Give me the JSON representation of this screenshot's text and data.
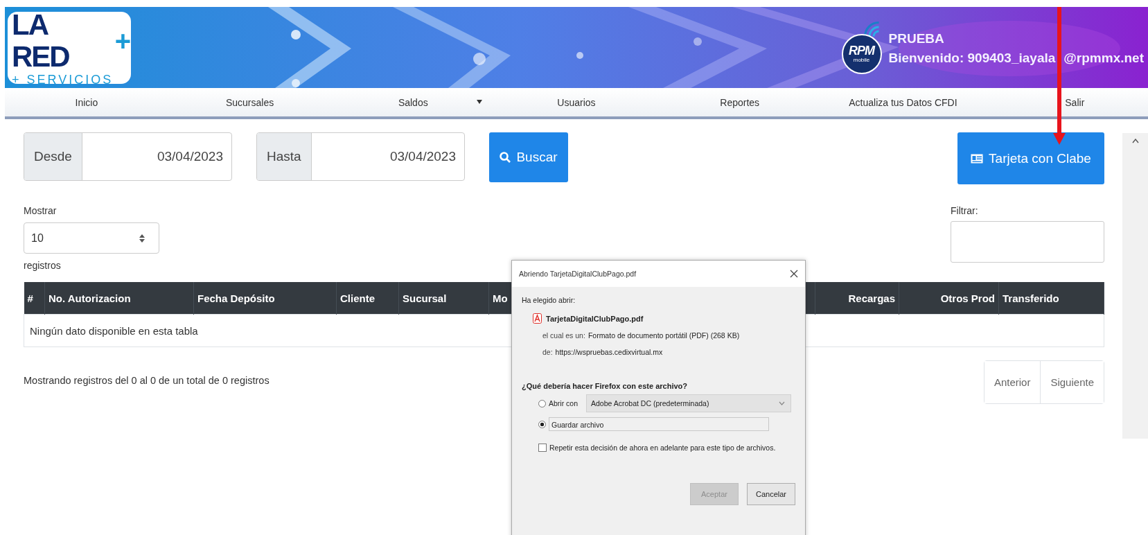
{
  "header": {
    "logo": {
      "main": "LA RED",
      "plus": "+",
      "sub": "+ SERVICIOS"
    },
    "brand": {
      "name": "RPM",
      "sub": "mobile"
    },
    "company": "PRUEBA",
    "welcome": "Bienvenido: 909403_iayala",
    "welcome_rest": "@rpmmx.net"
  },
  "nav": [
    {
      "label": "Inicio",
      "dropdown": false
    },
    {
      "label": "Sucursales",
      "dropdown": false
    },
    {
      "label": "Saldos",
      "dropdown": true
    },
    {
      "label": "Usuarios",
      "dropdown": false
    },
    {
      "label": "Reportes",
      "dropdown": false
    },
    {
      "label": "Actualiza tus Datos CFDI",
      "dropdown": false
    },
    {
      "label": "Salir",
      "dropdown": false
    }
  ],
  "date_range": [
    {
      "label": "Desde",
      "value": "03/04/2023"
    },
    {
      "label": "Hasta",
      "value": "03/04/2023"
    }
  ],
  "search_button": {
    "label": "Buscar"
  },
  "card_button": {
    "label": "Tarjeta con Clabe"
  },
  "length": {
    "label": "Mostrar",
    "value": "10",
    "suffix": "registros"
  },
  "filter": {
    "label": "Filtrar:"
  },
  "table": {
    "columns": [
      {
        "label": "#"
      },
      {
        "label": "No. Autorizacion"
      },
      {
        "label": "Fecha Depósito"
      },
      {
        "label": "Cliente"
      },
      {
        "label": "Sucursal"
      },
      {
        "label": "Mo"
      },
      {
        "label": "Recargas"
      },
      {
        "label": "Otros Prod"
      },
      {
        "label": "Transferido"
      }
    ],
    "empty": "Ningún dato disponible en esta tabla"
  },
  "info": "Mostrando registros del 0 al 0 de un total de 0 registros",
  "pagination": [
    {
      "label": "Anterior"
    },
    {
      "label": "Siguiente"
    }
  ],
  "dialog": {
    "title": "Abriendo TarjetaDigitalClubPago.pdf",
    "intro": "Ha elegido abrir:",
    "file_name": "TarjetaDigitalClubPago.pdf",
    "type_label": "el cual es un:",
    "type_value": "Formato de documento portátil (PDF) (268 KB)",
    "from_label": "de:",
    "from_value": "https://wspruebas.cedixvirtual.mx",
    "question": "¿Qué debería hacer Firefox con este archivo?",
    "options": [
      {
        "kind": "open_with",
        "label": "Abrir con",
        "app": "Adobe Acrobat DC (predeterminada)",
        "selected": false
      },
      {
        "kind": "save",
        "label": "Guardar archivo",
        "selected": true
      }
    ],
    "remember": {
      "label": "Repetir esta decisión de ahora en adelante para este tipo de archivos.",
      "checked": false
    },
    "buttons": [
      {
        "label": "Aceptar",
        "disabled": true
      },
      {
        "label": "Cancelar",
        "disabled": false
      }
    ]
  }
}
